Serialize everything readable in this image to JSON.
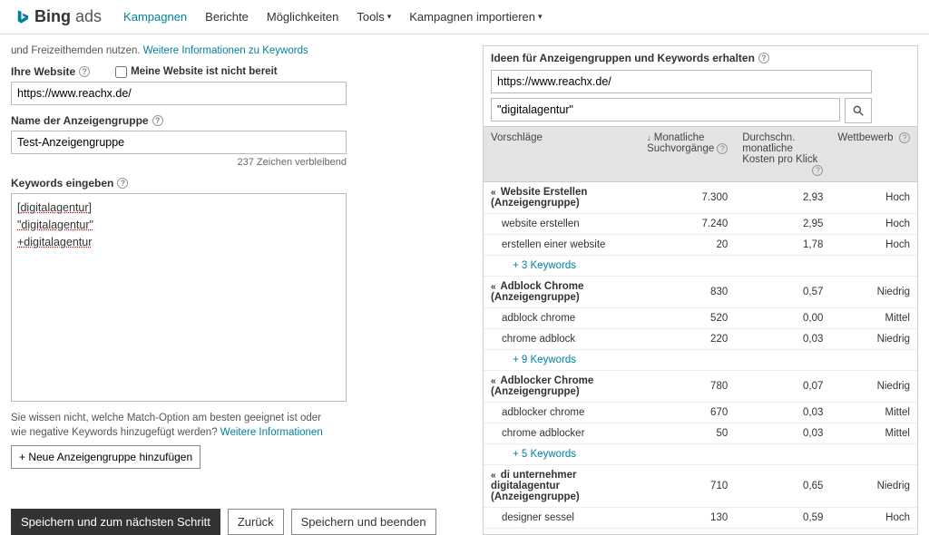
{
  "nav": {
    "logo_text_bold": "Bing",
    "logo_text_light": "ads",
    "items": [
      "Kampagnen",
      "Berichte",
      "Möglichkeiten",
      "Tools",
      "Kampagnen importieren"
    ]
  },
  "snippet_line": "und Freizeithemden nutzen.",
  "snippet_link": "Weitere Informationen zu Keywords",
  "website": {
    "label": "Ihre Website",
    "checkbox_label": "Meine Website ist nicht bereit",
    "value": "https://www.reachx.de/"
  },
  "adgroup": {
    "label": "Name der Anzeigengruppe",
    "value": "Test-Anzeigengruppe",
    "chars_remaining": "237 Zeichen verbleibend"
  },
  "keywords": {
    "label": "Keywords eingeben",
    "lines": [
      "[digitalagentur]",
      "\"digitalagentur\"",
      "+digitalagentur"
    ]
  },
  "match_note": "Sie wissen nicht, welche Match-Option am besten geeignet ist oder wie negative Keywords hinzugefügt werden?",
  "match_note_link": "Weitere Informationen",
  "add_adgroup_btn": "+ Neue Anzeigengruppe hinzufügen",
  "footer": {
    "save_next": "Speichern und zum nächsten Schritt",
    "back": "Zurück",
    "save_exit": "Speichern und beenden"
  },
  "ideas": {
    "header": "Ideen für Anzeigengruppen und Keywords erhalten",
    "url_value": "https://www.reachx.de/",
    "keyword_value": "\"digitalagentur\"",
    "cols": {
      "suggestions": "Vorschläge",
      "monthly": "Monatliche Suchvorgänge",
      "avg_cpc": "Durchschn. monatliche Kosten pro Klick",
      "competition": "Wettbewerb"
    },
    "groups": [
      {
        "name": "Website Erstellen (Anzeigengruppe)",
        "monthly": "7.300",
        "cpc": "2,93",
        "comp": "Hoch",
        "kws": [
          {
            "name": "website erstellen",
            "monthly": "7.240",
            "cpc": "2,95",
            "comp": "Hoch"
          },
          {
            "name": "erstellen einer website",
            "monthly": "20",
            "cpc": "1,78",
            "comp": "Hoch"
          }
        ],
        "more": "+ 3 Keywords"
      },
      {
        "name": "Adblock Chrome (Anzeigengruppe)",
        "monthly": "830",
        "cpc": "0,57",
        "comp": "Niedrig",
        "kws": [
          {
            "name": "adblock chrome",
            "monthly": "520",
            "cpc": "0,00",
            "comp": "Mittel"
          },
          {
            "name": "chrome adblock",
            "monthly": "220",
            "cpc": "0,03",
            "comp": "Niedrig"
          }
        ],
        "more": "+ 9 Keywords"
      },
      {
        "name": "Adblocker Chrome (Anzeigengruppe)",
        "monthly": "780",
        "cpc": "0,07",
        "comp": "Niedrig",
        "kws": [
          {
            "name": "adblocker chrome",
            "monthly": "670",
            "cpc": "0,03",
            "comp": "Mittel"
          },
          {
            "name": "chrome adblocker",
            "monthly": "50",
            "cpc": "0,03",
            "comp": "Mittel"
          }
        ],
        "more": "+ 5 Keywords"
      },
      {
        "name": "di unternehmer digitalagentur (Anzeigengruppe)",
        "monthly": "710",
        "cpc": "0,65",
        "comp": "Niedrig",
        "kws": [
          {
            "name": "designer sessel",
            "monthly": "130",
            "cpc": "0,59",
            "comp": "Hoch"
          }
        ],
        "more": ""
      }
    ]
  }
}
